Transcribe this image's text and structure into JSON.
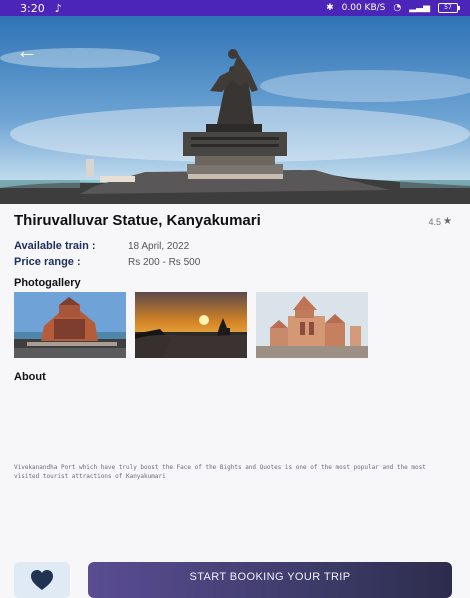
{
  "status_bar": {
    "time": "3:20",
    "network_speed": "0.00 KB/S",
    "battery": "57"
  },
  "place": {
    "title": "Thiruvalluvar Statue, Kanyakumari",
    "rating": "4.5"
  },
  "details": {
    "train_label": "Available train :",
    "train_value": "18 April,  2022",
    "price_label": "Price range :",
    "price_value": "Rs 200 - Rs 500"
  },
  "gallery": {
    "title": "Photogallery"
  },
  "about": {
    "title": "About",
    "text": "Vivekanandha Port which have truly boost the Face of the Bights and Quotes is one of the most popular and the most visited tourist attractions of Kanyakumari"
  },
  "actions": {
    "book_label": "START BOOKING YOUR TRIP"
  },
  "colors": {
    "status_bar": "#4b24b8",
    "label_color": "#21305e",
    "button_dark": "#393963",
    "favorite_bg": "#dfeaf4",
    "heart": "#203452"
  },
  "icons": {
    "back": "arrow-left-icon",
    "star": "star-icon",
    "favorite": "heart-icon",
    "music": "music-note-icon",
    "bluetooth": "bluetooth-icon",
    "wifi": "wifi-icon",
    "signal": "signal-icon"
  }
}
